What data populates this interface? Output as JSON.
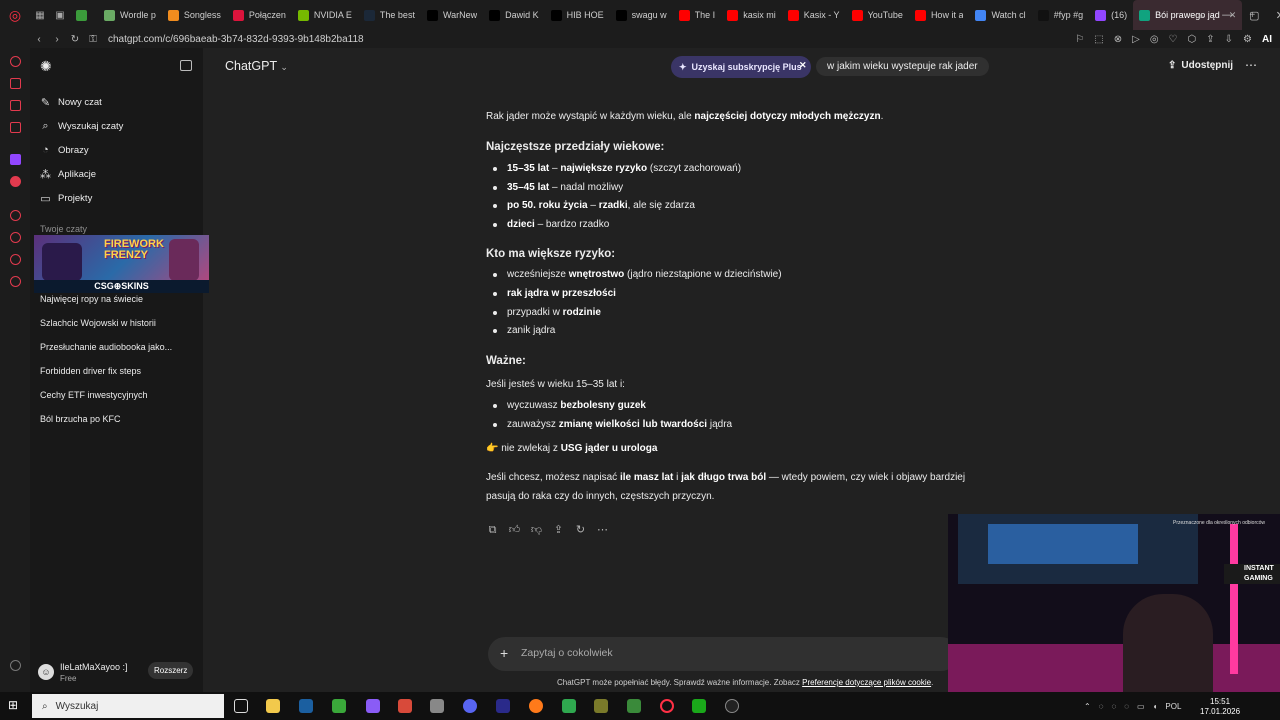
{
  "browser": {
    "tabs": [
      {
        "label": "",
        "color": "#3b9b3b"
      },
      {
        "label": "Wordle p",
        "color": "#6aaa64"
      },
      {
        "label": "Songless",
        "color": "#f08c1e"
      },
      {
        "label": "Połączen",
        "color": "#dc143c"
      },
      {
        "label": "NVIDIA E",
        "color": "#76b900"
      },
      {
        "label": "The best",
        "color": "#1b2838"
      },
      {
        "label": "WarNew",
        "color": "#000000"
      },
      {
        "label": "Dawid K",
        "color": "#000000"
      },
      {
        "label": "HIB HOE",
        "color": "#000000"
      },
      {
        "label": "swagu w",
        "color": "#000000"
      },
      {
        "label": "The I",
        "color": "#ff0000"
      },
      {
        "label": "kasix mi",
        "color": "#ff0000"
      },
      {
        "label": "Kasix - Y",
        "color": "#ff0000"
      },
      {
        "label": "YouTube",
        "color": "#ff0000"
      },
      {
        "label": "How it a",
        "color": "#ff0000"
      },
      {
        "label": "Watch cl",
        "color": "#4285f4"
      },
      {
        "label": "#fyp #g",
        "color": "#111111"
      },
      {
        "label": "(16)",
        "color": "#9146ff"
      },
      {
        "label": "Bói prawego jąd",
        "color": "#10a37f"
      }
    ],
    "url": "chatgpt.com/c/696baeab-3b74-832d-9393-9b148b2ba118",
    "ai_label": "AI"
  },
  "sidebar": {
    "items": [
      {
        "label": "Nowy czat",
        "icon": "edit-icon"
      },
      {
        "label": "Wyszukaj czaty",
        "icon": "search-icon"
      },
      {
        "label": "Obrazy",
        "icon": "image-icon"
      },
      {
        "label": "Aplikacje",
        "icon": "apps-icon"
      },
      {
        "label": "Projekty",
        "icon": "folder-icon"
      }
    ],
    "section_label": "Twoje czaty",
    "chats": [
      "Najwięcej ropy na świecie",
      "Szlachcic Wojowski w historii",
      "Przesłuchanie audiobooka jako...",
      "Forbidden driver fix steps",
      "Cechy ETF inwestycyjnych",
      "Ból brzucha po KFC"
    ],
    "user": {
      "name": "IleLatMaXayoo :]",
      "plan": "Free",
      "upgrade": "Rozszerz"
    }
  },
  "ad": {
    "top": "FIREWORK FRENZY",
    "brand": "CSG⊕SKINS"
  },
  "header": {
    "model": "ChatGPT",
    "plus_label": "Uzyskaj subskrypcję Plus",
    "query": "w jakim wieku wystepuje rak jader",
    "share": "Udostępnij"
  },
  "answer": {
    "intro_a": "Rak jąder może wystąpić w każdym wieku, ale ",
    "intro_b": "najczęściej dotyczy młodych mężczyzn",
    "intro_c": ".",
    "h1": "Najczęstsze przedziały wiekowe:",
    "ages": [
      {
        "b": "15–35 lat",
        "t": " – ",
        "b2": "największe ryzyko",
        "t2": " (szczyt zachorowań)"
      },
      {
        "b": "35–45 lat",
        "t": " – nadal możliwy",
        "b2": "",
        "t2": ""
      },
      {
        "b": "po 50. roku życia",
        "t": " – ",
        "b2": "rzadki",
        "t2": ", ale się zdarza"
      },
      {
        "b": "dzieci",
        "t": " – bardzo rzadko",
        "b2": "",
        "t2": ""
      }
    ],
    "h2": "Kto ma większe ryzyko:",
    "risks": [
      {
        "t": "wcześniejsze ",
        "b": "wnętrostwo",
        "t2": " (jądro niezstąpione w dzieciństwie)"
      },
      {
        "t": "",
        "b": "rak jądra w przeszłości",
        "t2": ""
      },
      {
        "t": "przypadki w ",
        "b": "rodzinie",
        "t2": ""
      },
      {
        "t": "zanik jądra",
        "b": "",
        "t2": ""
      }
    ],
    "h3": "Ważne:",
    "important_intro": "Jeśli jesteś w wieku 15–35 lat i:",
    "important": [
      {
        "t": "wyczuwasz ",
        "b": "bezbolesny guzek",
        "t2": ""
      },
      {
        "t": "zauważysz ",
        "b": "zmianę wielkości lub twardości",
        "t2": " jądra"
      }
    ],
    "cta_t": "nie zwlekaj z ",
    "cta_b": "USG jąder u urologa",
    "outro_a": "Jeśli chcesz, możesz napisać ",
    "outro_b": "ile masz lat",
    "outro_c": " i ",
    "outro_d": "jak długo trwa ból",
    "outro_e": " — wtedy powiem, czy wiek i objawy bardziej",
    "outro_f": "pasują do raka czy do innych, częstszych przyczyn."
  },
  "composer": {
    "placeholder": "Zapytaj o cokolwiek",
    "disclaimer": "ChatGPT może popełniać błędy. Sprawdź ważne informacje. Zobacz ",
    "disclaimer_link": "Preferencje dotyczące plików cookie",
    "disclaimer_end": "."
  },
  "webcam": {
    "sign": "INSTANT GAMING",
    "header": "Przeznaczone dla określonych odbiorców"
  },
  "taskbar": {
    "search": "Wyszukaj",
    "lang": "POL",
    "date": "17.01.2026",
    "time": "15:51"
  }
}
